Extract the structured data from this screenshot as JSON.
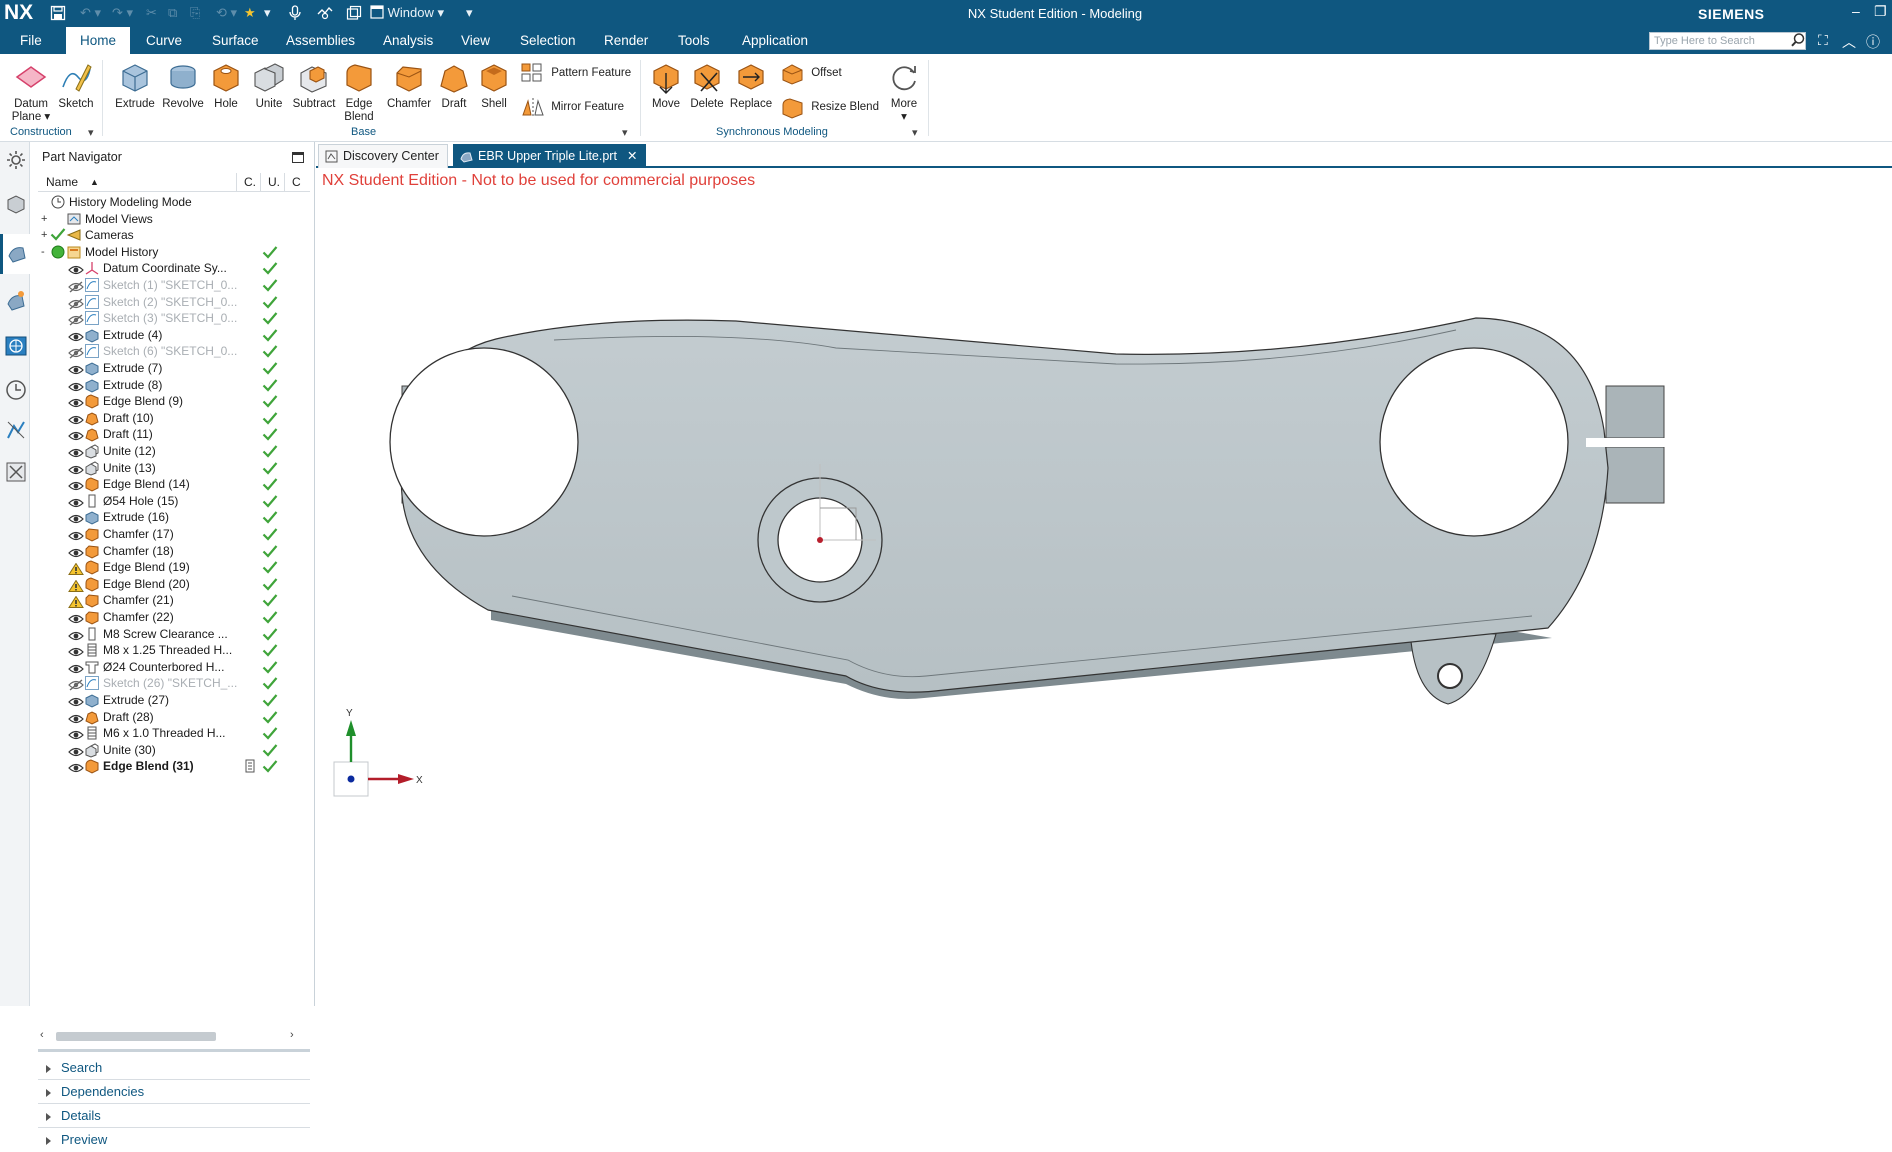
{
  "app": {
    "logo": "NX",
    "title": "NX Student Edition - Modeling",
    "brand": "SIEMENS",
    "window_menu": "Window",
    "accent": "#0f5780"
  },
  "menu": {
    "tabs": [
      "File",
      "Home",
      "Curve",
      "Surface",
      "Assemblies",
      "Analysis",
      "View",
      "Selection",
      "Render",
      "Tools",
      "Application"
    ],
    "active": "Home",
    "search_placeholder": "Type Here to Search"
  },
  "ribbon": {
    "construction": {
      "datum_plane": "Datum Plane",
      "sketch": "Sketch",
      "group": "Construction"
    },
    "base": {
      "extrude": "Extrude",
      "revolve": "Revolve",
      "hole": "Hole",
      "unite": "Unite",
      "subtract": "Subtract",
      "edge_blend": "Edge Blend",
      "chamfer": "Chamfer",
      "draft": "Draft",
      "shell": "Shell",
      "pattern_feature": "Pattern Feature",
      "mirror_feature": "Mirror Feature",
      "group": "Base"
    },
    "sync": {
      "move": "Move",
      "delete": "Delete",
      "replace": "Replace",
      "offset": "Offset",
      "resize_blend": "Resize Blend",
      "more": "More",
      "group": "Synchronous Modeling"
    }
  },
  "navigator": {
    "title": "Part Navigator",
    "columns": {
      "name": "Name",
      "c": "C.",
      "u": "U.",
      "c2": "C"
    },
    "rows": [
      {
        "label": "History Modeling Mode",
        "type": "mode",
        "indent": 1
      },
      {
        "label": "Model Views",
        "type": "views",
        "indent": 0,
        "expander": "+"
      },
      {
        "label": "Cameras",
        "type": "cameras",
        "indent": 0,
        "expander": "+"
      },
      {
        "label": "Model History",
        "type": "history",
        "indent": 0,
        "expander": "-"
      },
      {
        "label": "Datum Coordinate Sy...",
        "type": "datum",
        "vis": "on"
      },
      {
        "label": "Sketch (1) \"SKETCH_0...",
        "type": "sketch",
        "vis": "off"
      },
      {
        "label": "Sketch (2) \"SKETCH_0...",
        "type": "sketch",
        "vis": "off"
      },
      {
        "label": "Sketch (3) \"SKETCH_0...",
        "type": "sketch",
        "vis": "off"
      },
      {
        "label": "Extrude (4)",
        "type": "extrude",
        "vis": "on"
      },
      {
        "label": "Sketch (6) \"SKETCH_0...",
        "type": "sketch",
        "vis": "off"
      },
      {
        "label": "Extrude (7)",
        "type": "extrude",
        "vis": "on"
      },
      {
        "label": "Extrude (8)",
        "type": "extrude",
        "vis": "on"
      },
      {
        "label": "Edge Blend (9)",
        "type": "blend",
        "vis": "on"
      },
      {
        "label": "Draft (10)",
        "type": "draft",
        "vis": "on"
      },
      {
        "label": "Draft (11)",
        "type": "draft",
        "vis": "on"
      },
      {
        "label": "Unite (12)",
        "type": "unite",
        "vis": "on"
      },
      {
        "label": "Unite (13)",
        "type": "unite",
        "vis": "on"
      },
      {
        "label": "Edge Blend (14)",
        "type": "blend",
        "vis": "on"
      },
      {
        "label": "Ø54 Hole (15)",
        "type": "hole",
        "vis": "on"
      },
      {
        "label": "Extrude (16)",
        "type": "extrude",
        "vis": "on"
      },
      {
        "label": "Chamfer (17)",
        "type": "chamfer",
        "vis": "on"
      },
      {
        "label": "Chamfer (18)",
        "type": "chamfer",
        "vis": "on"
      },
      {
        "label": "Edge Blend (19)",
        "type": "blend",
        "vis": "warn"
      },
      {
        "label": "Edge Blend (20)",
        "type": "blend",
        "vis": "warn"
      },
      {
        "label": "Chamfer (21)",
        "type": "chamfer",
        "vis": "warn"
      },
      {
        "label": "Chamfer (22)",
        "type": "chamfer",
        "vis": "on"
      },
      {
        "label": "M8 Screw Clearance ...",
        "type": "hole",
        "vis": "on"
      },
      {
        "label": "M8 x 1.25 Threaded H...",
        "type": "thread",
        "vis": "on"
      },
      {
        "label": "Ø24 Counterbored H...",
        "type": "cbore",
        "vis": "on"
      },
      {
        "label": "Sketch (26) \"SKETCH_...",
        "type": "sketch",
        "vis": "off"
      },
      {
        "label": "Extrude (27)",
        "type": "extrude",
        "vis": "on"
      },
      {
        "label": "Draft (28)",
        "type": "draft",
        "vis": "on"
      },
      {
        "label": "M6 x 1.0 Threaded H...",
        "type": "thread",
        "vis": "on"
      },
      {
        "label": "Unite (30)",
        "type": "unite",
        "vis": "on"
      },
      {
        "label": "Edge Blend (31)",
        "type": "blend",
        "vis": "on",
        "bold": true,
        "current": true
      }
    ],
    "sections": [
      "Search",
      "Dependencies",
      "Details",
      "Preview"
    ]
  },
  "graphics": {
    "tabs": [
      {
        "label": "Discovery Center",
        "active": false
      },
      {
        "label": "EBR Upper Triple Lite.prt",
        "active": true
      }
    ],
    "close_glyph": "✕",
    "watermark": "NX Student Edition - Not to be used for commercial purposes",
    "triad": {
      "x": "X",
      "y": "Y"
    }
  }
}
